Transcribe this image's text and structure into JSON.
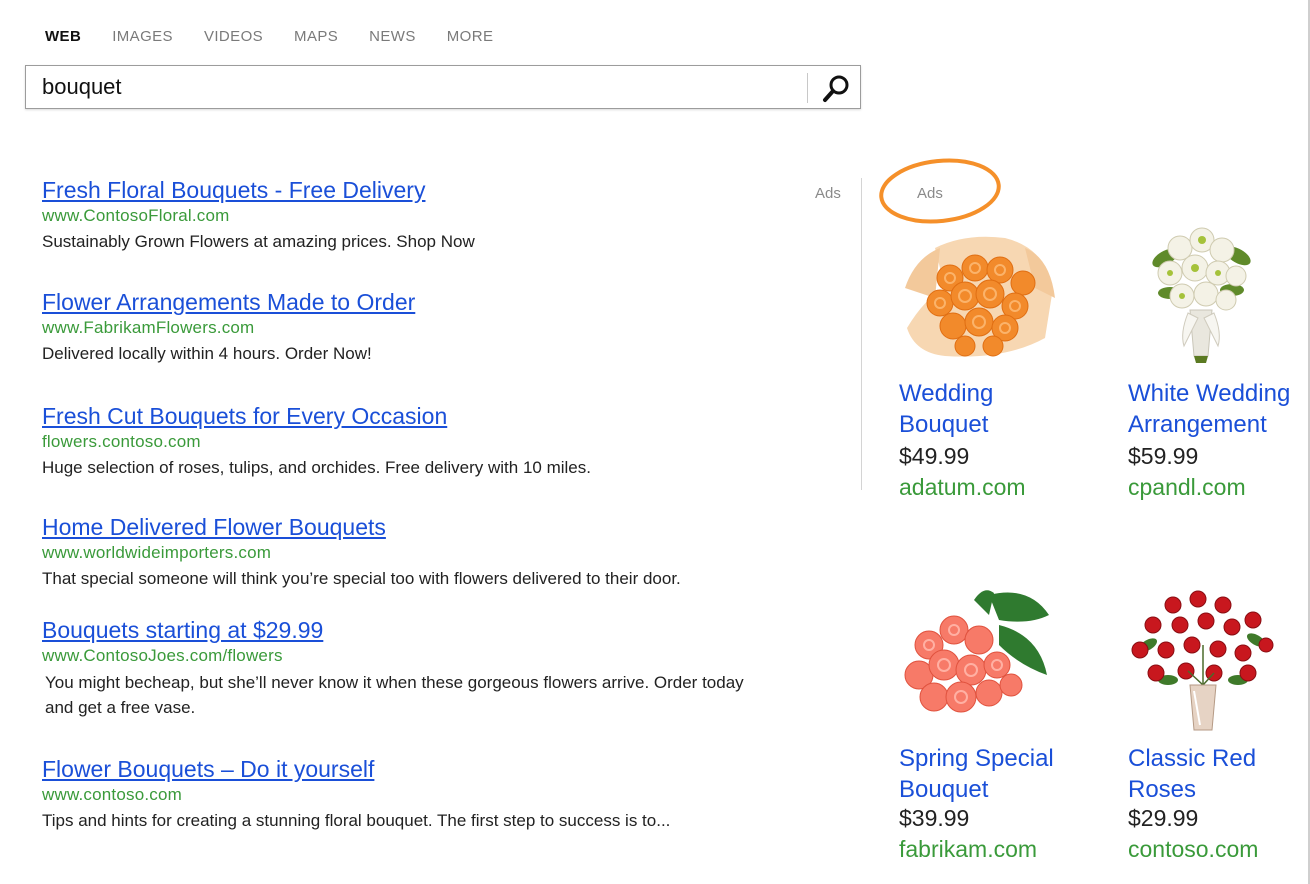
{
  "nav": {
    "tabs": [
      {
        "label": "WEB",
        "active": true
      },
      {
        "label": "IMAGES",
        "active": false
      },
      {
        "label": "VIDEOS",
        "active": false
      },
      {
        "label": "MAPS",
        "active": false
      },
      {
        "label": "NEWS",
        "active": false
      },
      {
        "label": "MORE",
        "active": false
      }
    ]
  },
  "search": {
    "query": "bouquet",
    "button_icon": "search-icon"
  },
  "main_ads_label": "Ads",
  "results": [
    {
      "title": "Fresh Floral Bouquets - Free Delivery",
      "url": "www.ContosoFloral.com",
      "description": "Sustainably Grown Flowers at amazing prices. Shop Now"
    },
    {
      "title": "Flower Arrangements Made to Order ",
      "url": "www.FabrikamFlowers.com",
      "description": "Delivered locally within 4 hours.  Order Now!"
    },
    {
      "title": "Fresh Cut Bouquets for Every Occasion",
      "url": "flowers.contoso.com",
      "description": "Huge selection of roses, tulips, and orchides. Free delivery with 10 miles."
    },
    {
      "title": "Home Delivered Flower Bouquets",
      "url": "www.worldwideimporters.com",
      "description": "That special someone will think you’re special too with flowers delivered to their door."
    },
    {
      "title": "Bouquets starting at $29.99",
      "url": "www.ContosoJoes.com/flowers",
      "description": "You might becheap, but she’ll never know it when these gorgeous flowers arrive. Order today and get a free vase."
    },
    {
      "title": "Flower Bouquets – Do it yourself",
      "url": "www.contoso.com",
      "description": "Tips and hints for creating a stunning floral bouquet. The first step to success is to..."
    }
  ],
  "side_ads": {
    "label": "Ads",
    "highlight_color": "#f5902a",
    "products": [
      {
        "name": "Wedding Bouquet",
        "price": "$49.99",
        "site": "adatum.com",
        "image": "orange-rose-bouquet-image"
      },
      {
        "name": "White Wedding Arrangement",
        "price": "$59.99",
        "site": "cpandl.com",
        "image": "white-flower-bouquet-image"
      },
      {
        "name": "Spring Special Bouquet",
        "price": "$39.99",
        "site": "fabrikam.com",
        "image": "pink-rose-bouquet-image"
      },
      {
        "name": "Classic Red Roses",
        "price": "$29.99",
        "site": "contoso.com",
        "image": "red-roses-vase-image"
      }
    ]
  },
  "colors": {
    "link": "#1a4fd8",
    "url_green": "#3a9a3a",
    "muted": "#8a8a8a"
  }
}
